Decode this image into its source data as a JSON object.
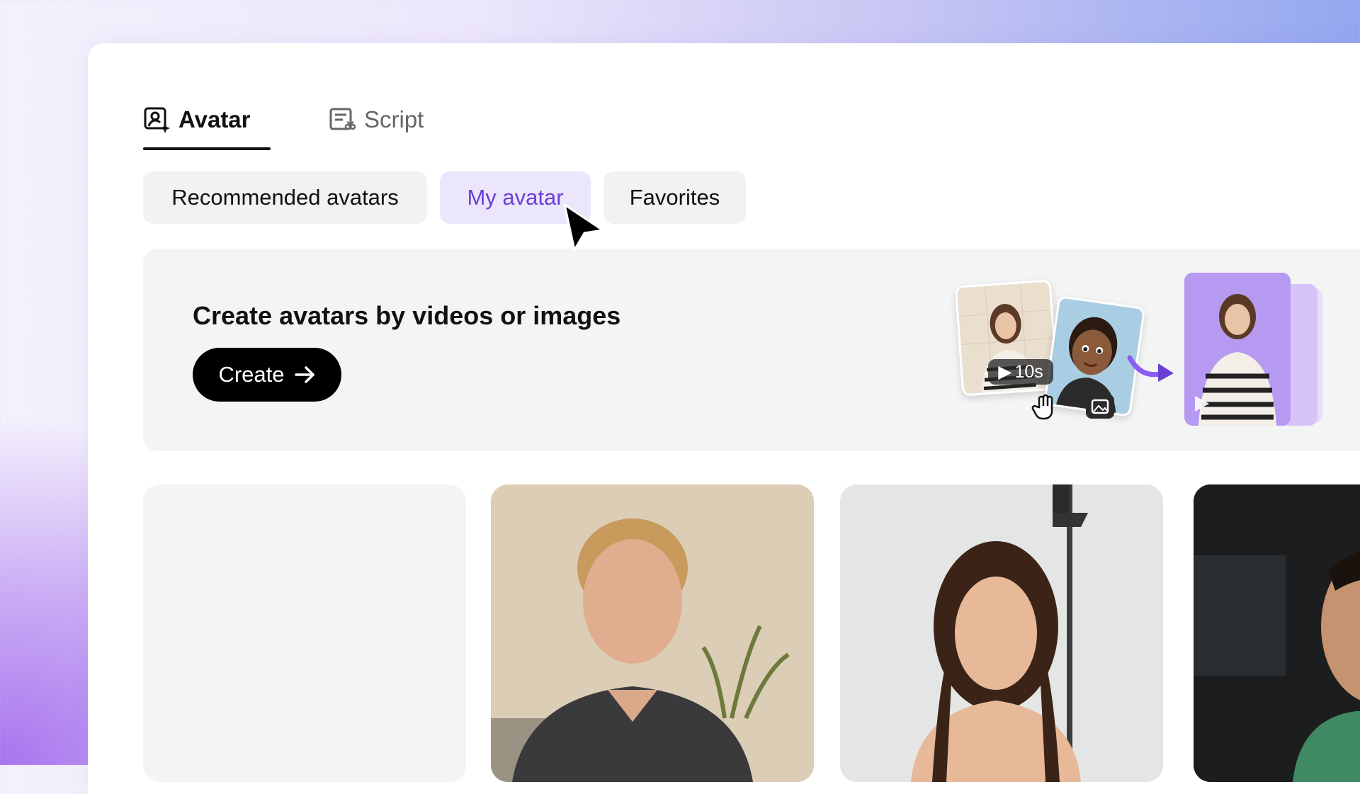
{
  "tabs": [
    {
      "label": "Avatar",
      "icon": "avatar-icon",
      "active": true
    },
    {
      "label": "Script",
      "icon": "script-icon",
      "active": false
    }
  ],
  "subtabs": {
    "recommended": "Recommended avatars",
    "my_avatar": "My avatar",
    "favorites": "Favorites",
    "selected": "My avatar"
  },
  "banner": {
    "title": "Create avatars by videos or images",
    "create_button": "Create",
    "video_duration": "10s"
  },
  "colors": {
    "accent": "#6b3fd4",
    "accent_bg": "#ece6fc",
    "chip_bg": "#f1f3f3",
    "button_bg": "#000000"
  },
  "avatar_tiles": [
    {
      "type": "empty"
    },
    {
      "type": "video",
      "subject": "man-avatar"
    },
    {
      "type": "video",
      "subject": "woman-avatar"
    },
    {
      "type": "video",
      "subject": "man-in-car-avatar"
    }
  ]
}
